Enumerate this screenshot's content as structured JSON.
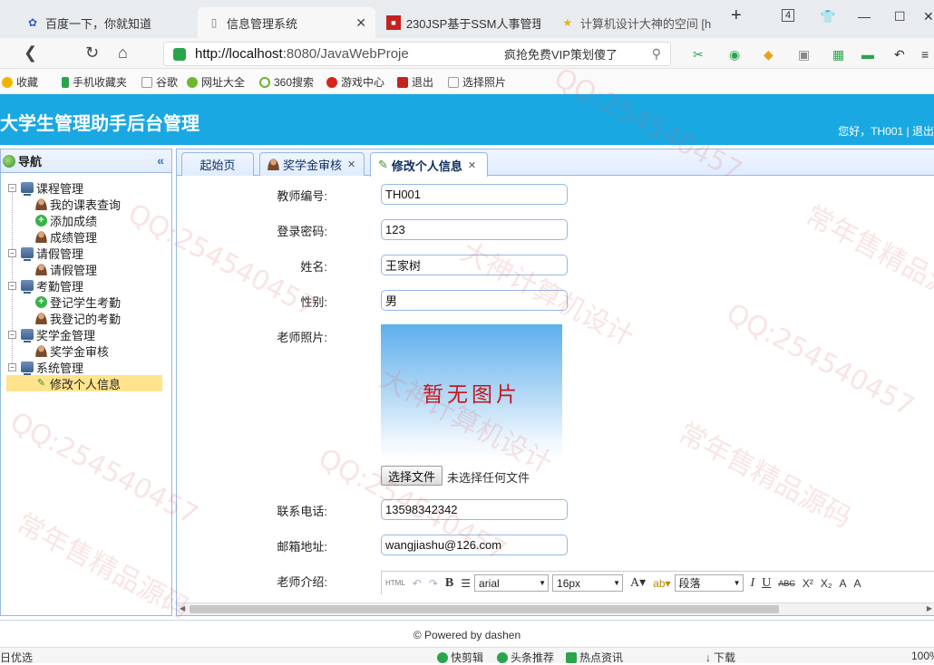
{
  "browser": {
    "tabs": [
      {
        "title": "百度一下，你就知道",
        "icon": "paw-icon",
        "active": false
      },
      {
        "title": "信息管理系统",
        "icon": "document-icon",
        "active": true
      },
      {
        "title": "230JSP基于SSM人事管理",
        "icon": "red-square-icon",
        "active": false
      },
      {
        "title": "计算机设计大神的空间 [h",
        "icon": "star-icon",
        "active": false
      }
    ],
    "new_tab": "+",
    "tab_count": "4",
    "url_host": "http://localhost",
    "url_rest": ":8080/JavaWebProje",
    "promo_text": "疯抢免费VIP策划傻了",
    "bookmarks": [
      "收藏",
      "手机收藏夹",
      "谷歌",
      "网址大全",
      "360搜索",
      "游戏中心",
      "退出",
      "选择照片"
    ],
    "status_left": "日优选",
    "status_items": [
      "快剪辑",
      "头条推荐",
      "热点资讯",
      "下载",
      "100%"
    ]
  },
  "header": {
    "title": "大学生管理助手后台管理",
    "user_text": "您好，TH001 | 退出"
  },
  "nav": {
    "title": "导航",
    "groups": [
      {
        "label": "课程管理",
        "items": [
          {
            "label": "我的课表查询",
            "icon": "person"
          },
          {
            "label": "添加成绩",
            "icon": "add"
          },
          {
            "label": "成绩管理",
            "icon": "person"
          }
        ]
      },
      {
        "label": "请假管理",
        "items": [
          {
            "label": "请假管理",
            "icon": "person"
          }
        ]
      },
      {
        "label": "考勤管理",
        "items": [
          {
            "label": "登记学生考勤",
            "icon": "add"
          },
          {
            "label": "我登记的考勤",
            "icon": "person"
          }
        ]
      },
      {
        "label": "奖学金管理",
        "items": [
          {
            "label": "奖学金审核",
            "icon": "person"
          }
        ]
      },
      {
        "label": "系统管理",
        "items": [
          {
            "label": "修改个人信息",
            "icon": "pencil",
            "selected": true
          }
        ]
      }
    ]
  },
  "tabs": [
    {
      "label": "起始页",
      "closable": false
    },
    {
      "label": "奖学金审核",
      "closable": true
    },
    {
      "label": "修改个人信息",
      "closable": true,
      "active": true
    }
  ],
  "form": {
    "teacher_id_label": "教师编号:",
    "teacher_id": "TH001",
    "password_label": "登录密码:",
    "password": "123",
    "name_label": "姓名:",
    "name": "王家树",
    "gender_label": "性别:",
    "gender": "男",
    "photo_label": "老师照片:",
    "photo_placeholder": "暂无图片",
    "file_button": "选择文件",
    "file_status": "未选择任何文件",
    "phone_label": "联系电话:",
    "phone": "13598342342",
    "email_label": "邮箱地址:",
    "email": "wangjiashu@126.com",
    "intro_label": "老师介绍:"
  },
  "editor": {
    "html": "HTML",
    "bold": "B",
    "font": "arial",
    "size": "16px",
    "paragraph": "段落",
    "italic": "I",
    "underline": "U",
    "strike": "ABC",
    "sup": "X²",
    "sub": "X₂"
  },
  "footer": {
    "text": "© Powered by dashen"
  },
  "watermarks": [
    "QQ:254540457",
    "大神计算机设计",
    "常年售精品源码"
  ]
}
